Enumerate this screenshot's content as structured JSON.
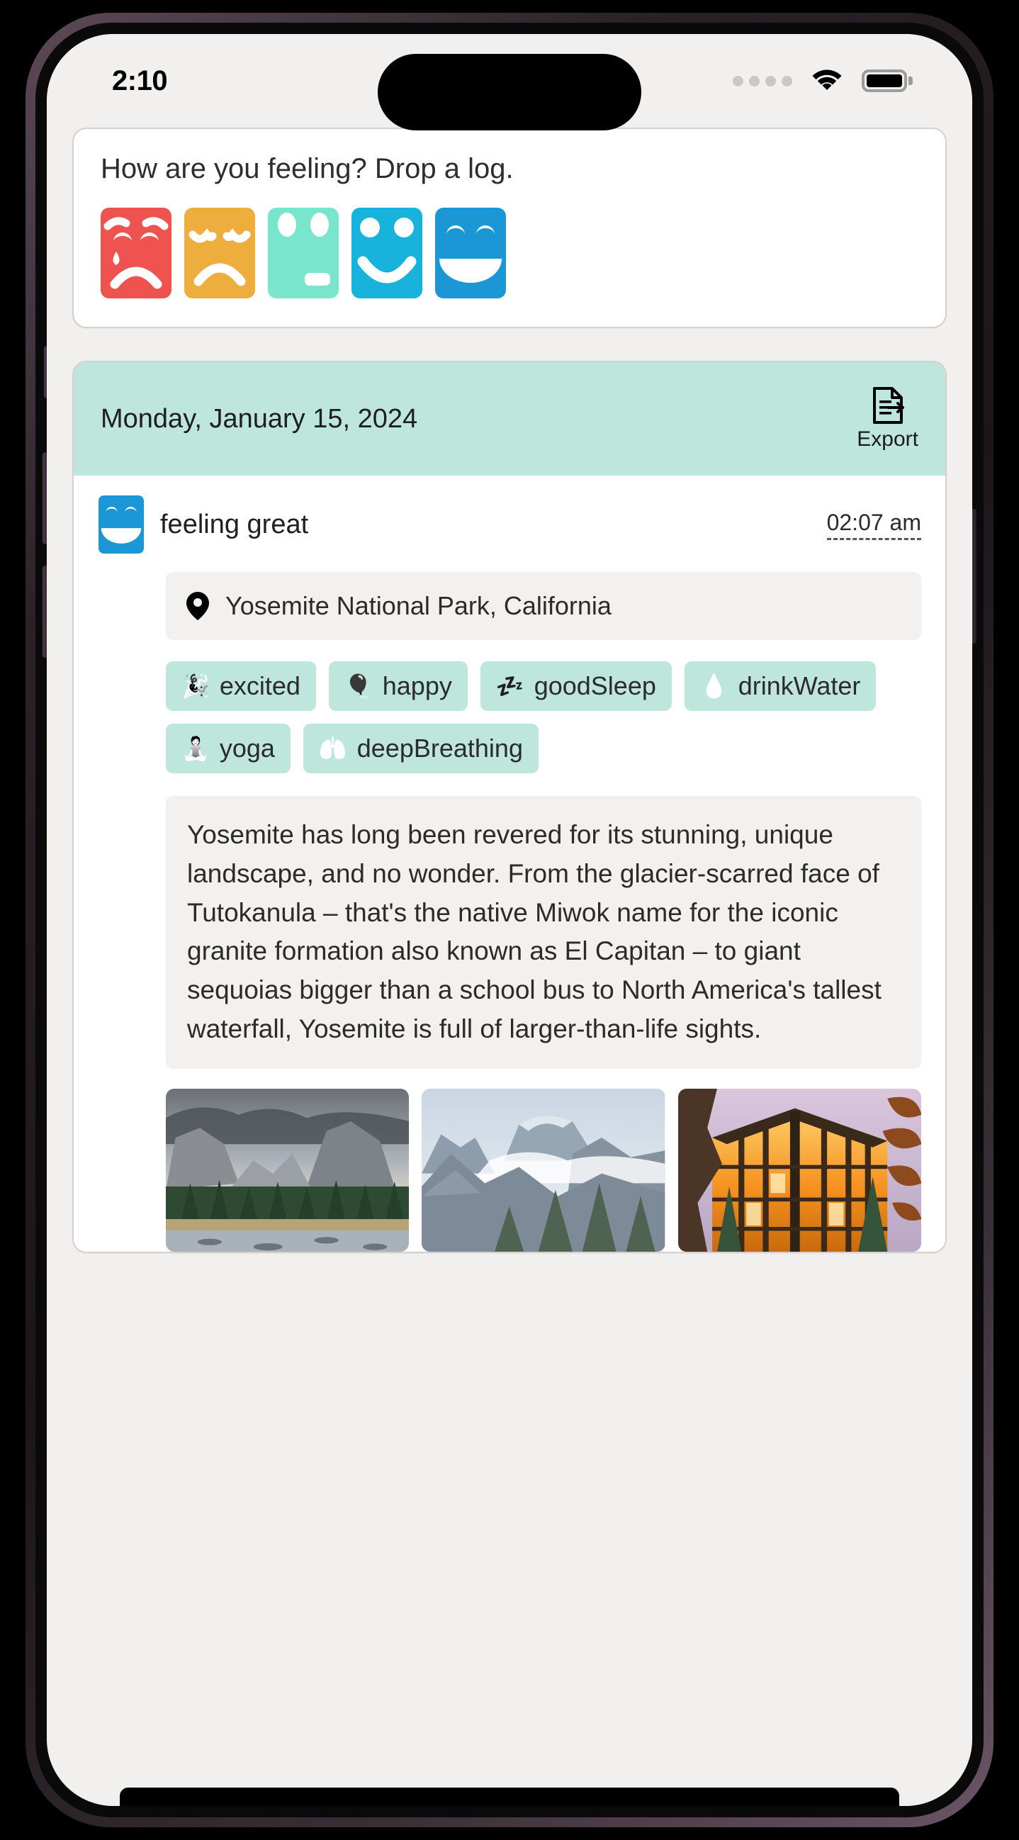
{
  "status_bar": {
    "time": "2:10",
    "signal_icon": "cellular-dots-icon",
    "wifi_icon": "wifi-icon",
    "battery_icon": "battery-full-icon"
  },
  "mood_prompt_card": {
    "prompt": "How are you feeling? Drop a log.",
    "moods": [
      {
        "name": "very-sad",
        "label": "very sad",
        "color": "#ef5350"
      },
      {
        "name": "sad",
        "label": "sad",
        "color": "#eeae3e"
      },
      {
        "name": "neutral",
        "label": "neutral",
        "color": "#7ae5cd"
      },
      {
        "name": "happy",
        "label": "happy",
        "color": "#18b3dd"
      },
      {
        "name": "great",
        "label": "great",
        "color": "#1b97d6"
      }
    ]
  },
  "log": {
    "date": "Monday, January 15, 2024",
    "export_label": "Export",
    "export_icon": "document-export-icon",
    "entry": {
      "mood_icon": "mood-great-icon",
      "mood_label": "feeling great",
      "time": "02:07 am",
      "location_icon": "location-pin-icon",
      "location": "Yosemite National Park, California",
      "tags": [
        {
          "icon": "party-popper-icon",
          "glyph": "🎉",
          "label": "excited"
        },
        {
          "icon": "balloons-icon",
          "glyph": "🎈",
          "label": "happy"
        },
        {
          "icon": "sleeping-moon-icon",
          "glyph": "💤",
          "label": "goodSleep"
        },
        {
          "icon": "water-drop-icon",
          "glyph": "💧",
          "label": "drinkWater"
        },
        {
          "icon": "yoga-pose-icon",
          "glyph": "🧘",
          "label": "yoga"
        },
        {
          "icon": "lungs-icon",
          "glyph": "🫁",
          "label": "deepBreathing"
        }
      ],
      "note": "Yosemite has long been revered for its stunning, unique landscape, and no wonder. From the glacier-scarred face of Tutokanula – that's the native Miwok name for the iconic granite formation also known as El Capitan – to giant sequoias bigger than a school bus to North America's tallest waterfall, Yosemite is full of larger-than-life sights.",
      "photos": [
        {
          "name": "photo-yosemite-valley",
          "alt": "Yosemite Valley with El Capitan and river"
        },
        {
          "name": "photo-half-dome",
          "alt": "Half Dome shrouded in clouds"
        },
        {
          "name": "photo-glass-lodge",
          "alt": "Illuminated glass lodge at dusk"
        }
      ]
    }
  },
  "colors": {
    "page_bg": "#f1f0ee",
    "card_bg": "#ffffff",
    "accent_mint": "#bfe6dc",
    "muted_panel": "#f2f1ef",
    "border": "#d8cfcb"
  }
}
